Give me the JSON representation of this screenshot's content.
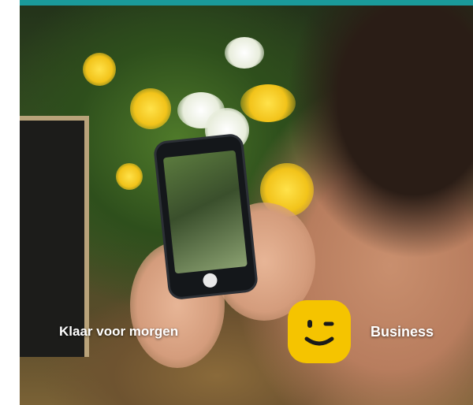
{
  "banner": {
    "tagline": "Klaar voor morgen",
    "brand": "Business",
    "accent_color": "#1a9a9a",
    "logo_color": "#f5c400",
    "logo_icon": "winking-face-logo-icon"
  },
  "photo": {
    "subject_icon": "person-photographing-flowers-with-phone"
  }
}
